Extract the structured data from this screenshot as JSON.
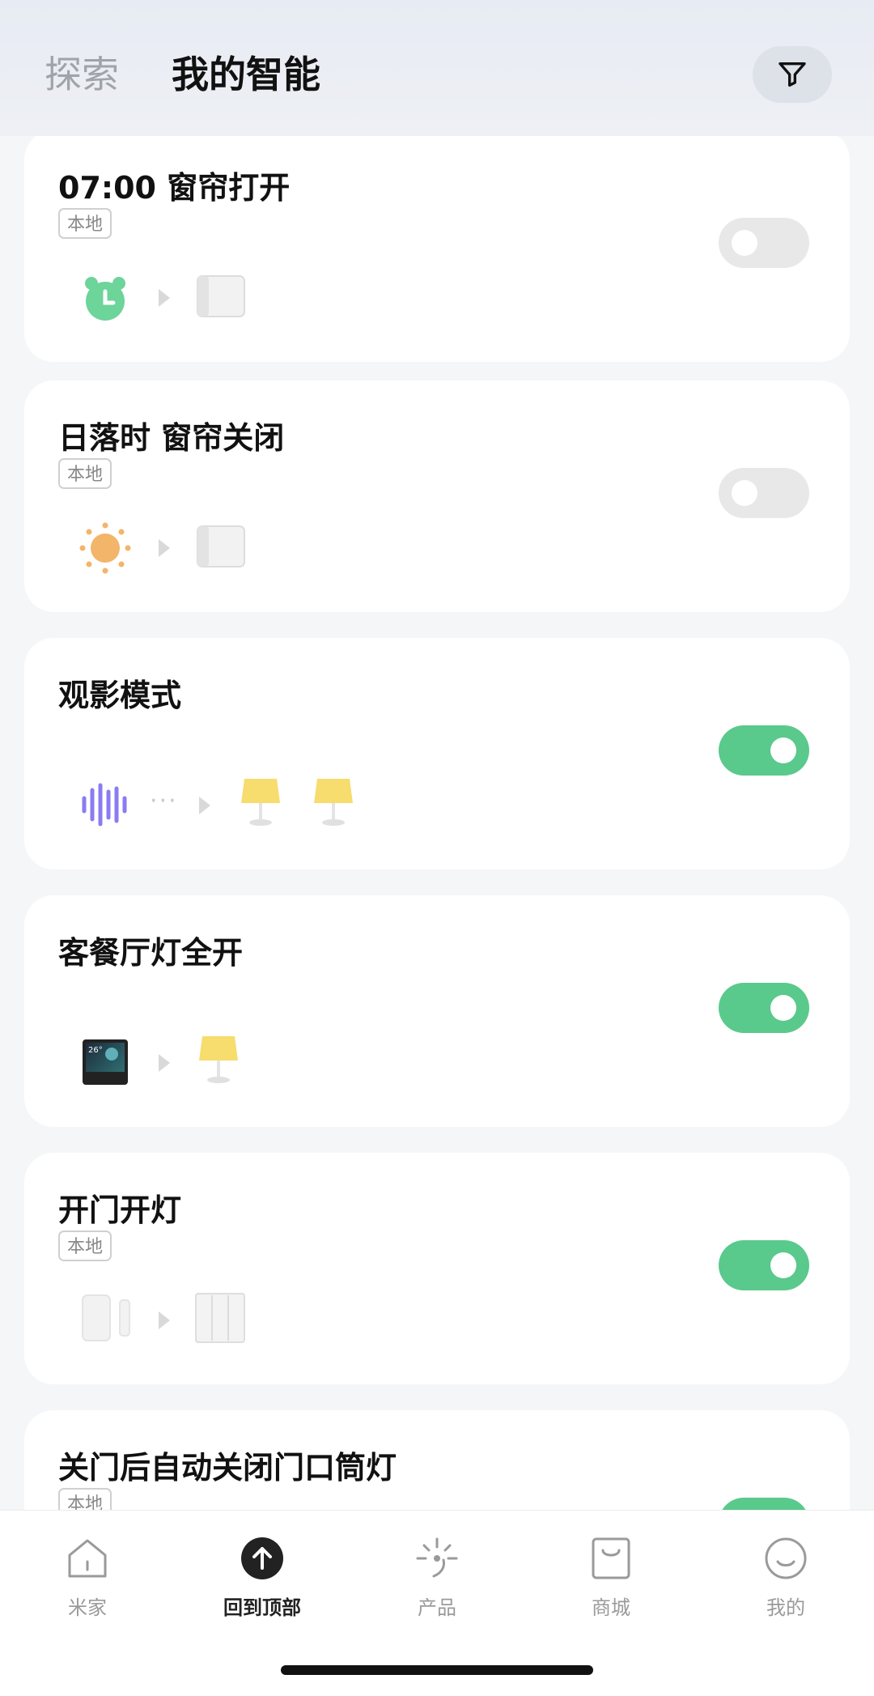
{
  "header": {
    "tab_explore": "探索",
    "tab_mine": "我的智能",
    "filter_icon": "filter-icon"
  },
  "cards": [
    {
      "title": "07:00 窗帘打开",
      "badge": "本地",
      "enabled": false,
      "trigger_icon": "alarm-clock-icon",
      "target_icons": [
        "curtain-motor-icon"
      ]
    },
    {
      "title": "日落时 窗帘关闭",
      "badge": "本地",
      "enabled": false,
      "trigger_icon": "sun-icon",
      "target_icons": [
        "curtain-motor-icon"
      ]
    },
    {
      "title": "观影模式",
      "badge": "",
      "enabled": true,
      "trigger_icon": "voice-wave-icon",
      "target_icons": [
        "table-lamp-icon",
        "table-lamp-icon"
      ]
    },
    {
      "title": "客餐厅灯全开",
      "badge": "",
      "enabled": true,
      "trigger_icon": "smart-panel-icon",
      "target_icons": [
        "table-lamp-icon"
      ]
    },
    {
      "title": "开门开灯",
      "badge": "本地",
      "enabled": true,
      "trigger_icon": "door-sensor-icon",
      "target_icons": [
        "wall-switch-icon"
      ]
    },
    {
      "title": "关门后自动关闭门口筒灯",
      "badge": "本地",
      "enabled": true,
      "trigger_icon": "",
      "target_icons": []
    }
  ],
  "panel_temp": "26°",
  "ellipsis": "···",
  "bottom_nav": [
    {
      "label": "米家",
      "icon": "home-icon"
    },
    {
      "label": "回到顶部",
      "icon": "arrow-up-icon"
    },
    {
      "label": "产品",
      "icon": "sparkle-icon"
    },
    {
      "label": "商城",
      "icon": "shopping-bag-icon"
    },
    {
      "label": "我的",
      "icon": "smile-icon"
    }
  ],
  "colors": {
    "toggle_on": "#5ac98c",
    "toggle_off": "#e8e8e8",
    "alarm": "#6dd49a",
    "sun": "#f3b56a",
    "voice": "#8a7cf0",
    "lamp": "#f7dc6e"
  }
}
